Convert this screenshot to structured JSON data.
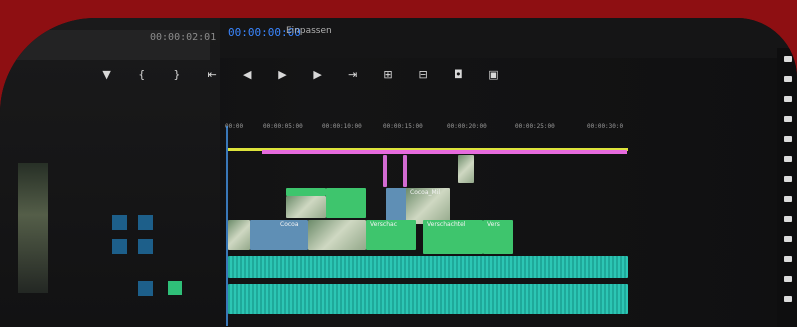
{
  "top_bar": {
    "timecode_left": "00:00:02:01",
    "timecode": "00:00:00:00",
    "fit_label": "Einpassen"
  },
  "transport_controls": [
    "marker-icon",
    "mark-in-icon",
    "mark-out-icon",
    "go-to-in-icon",
    "step-back-icon",
    "play-icon",
    "step-forward-icon",
    "go-to-out-icon",
    "insert-icon",
    "overwrite-icon",
    "export-frame-icon",
    "compare-icon"
  ],
  "ruler_ticks": [
    "00:00",
    "00:00:05:00",
    "00:00:10:00",
    "00:00:15:00",
    "00:00:20:00",
    "00:00:25:00",
    "00:00:30:0"
  ],
  "clips": {
    "label_1": "Cocoa_Mil",
    "label_2": "Cocoa",
    "label_3": "Verschac",
    "label_4": "Verschachtel",
    "label_5": "Vers"
  },
  "colors": {
    "background": "#8e0f12",
    "timecode": "#3a86ff",
    "clip_pink": "#d26bd2",
    "clip_green": "#3ec56d",
    "audio": "#1fa99a",
    "yellow": "#dde33b"
  }
}
